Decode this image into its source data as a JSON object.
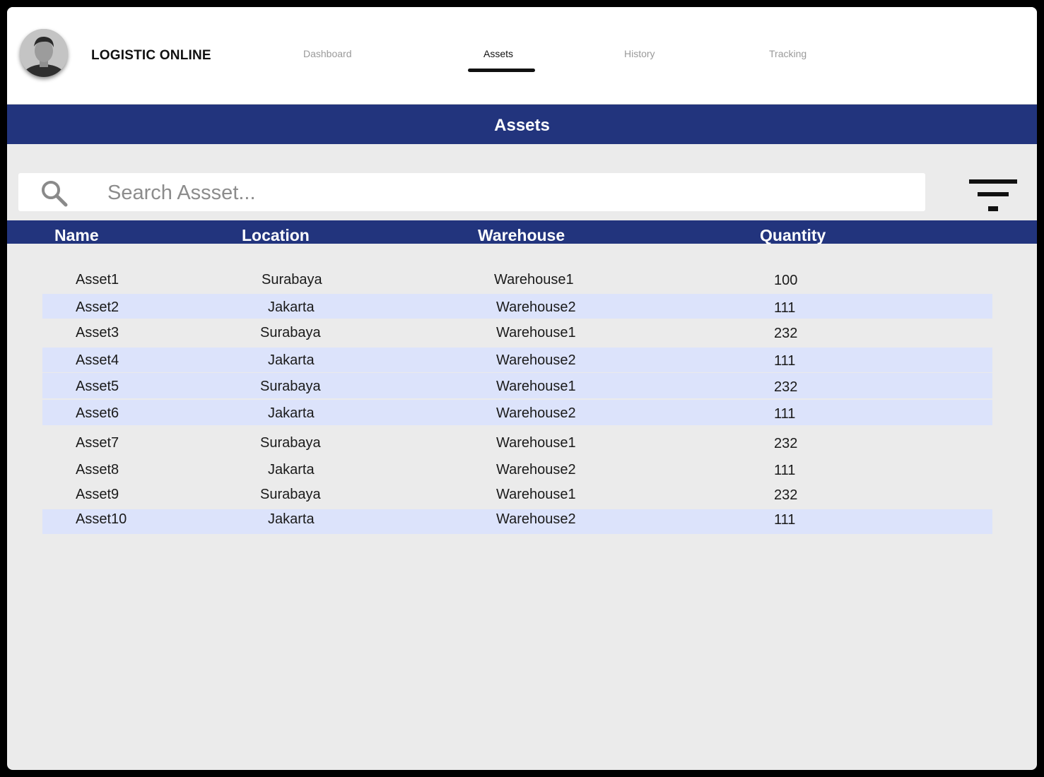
{
  "app": {
    "title": "LOGISTIC ONLINE",
    "nav_tabs": [
      {
        "label": "Dashboard",
        "active": false
      },
      {
        "label": "Assets",
        "active": true
      },
      {
        "label": "History",
        "active": false
      },
      {
        "label": "Tracking",
        "active": false
      }
    ]
  },
  "page": {
    "heading": "Assets"
  },
  "search": {
    "placeholder": "Search Assset...",
    "value": ""
  },
  "table": {
    "columns": [
      "Name",
      "Location",
      "Warehouse",
      "Quantity"
    ],
    "rows": [
      {
        "name": "Asset1",
        "location": "Surabaya",
        "warehouse": "Warehouse1",
        "quantity": "100",
        "highlighted": false
      },
      {
        "name": "Asset2",
        "location": "Jakarta",
        "warehouse": "Warehouse2",
        "quantity": "111",
        "highlighted": true
      },
      {
        "name": "Asset3",
        "location": "Surabaya",
        "warehouse": "Warehouse1",
        "quantity": "232",
        "highlighted": false
      },
      {
        "name": "Asset4",
        "location": "Jakarta",
        "warehouse": "Warehouse2",
        "quantity": "111",
        "highlighted": true
      },
      {
        "name": "Asset5",
        "location": "Surabaya",
        "warehouse": "Warehouse1",
        "quantity": "232",
        "highlighted": true
      },
      {
        "name": "Asset6",
        "location": "Jakarta",
        "warehouse": "Warehouse2",
        "quantity": "111",
        "highlighted": true
      },
      {
        "name": "Asset7",
        "location": "Surabaya",
        "warehouse": "Warehouse1",
        "quantity": "232",
        "highlighted": false
      },
      {
        "name": "Asset8",
        "location": "Jakarta",
        "warehouse": "Warehouse2",
        "quantity": "111",
        "highlighted": false
      },
      {
        "name": "Asset9",
        "location": "Surabaya",
        "warehouse": "Warehouse1",
        "quantity": "232",
        "highlighted": false
      },
      {
        "name": "Asset10",
        "location": "Jakarta",
        "warehouse": "Warehouse2",
        "quantity": "111",
        "highlighted": true
      }
    ]
  },
  "icons": {
    "search": "search-icon",
    "filter": "filter-icon",
    "avatar": "user-avatar"
  },
  "colors": {
    "primary": "#22347d",
    "row_highlight": "#dce3fb",
    "background": "#ebebeb"
  }
}
